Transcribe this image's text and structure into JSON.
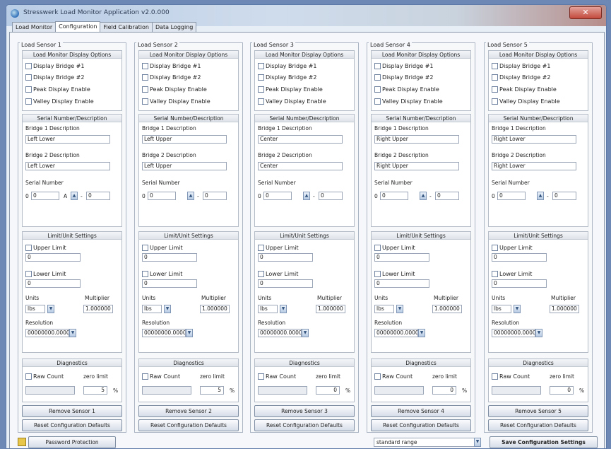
{
  "window": {
    "title": "Stresswerk Load Monitor Application v2.0.000",
    "close_symbol": "✕"
  },
  "tabs": [
    {
      "label": "Load Monitor",
      "active": false
    },
    {
      "label": "Configuration",
      "active": true
    },
    {
      "label": "Field Calibration",
      "active": false
    },
    {
      "label": "Data Logging",
      "active": false
    }
  ],
  "labels": {
    "display_options": "Load Monitor Display Options",
    "display_bridge_1": "Display Bridge #1",
    "display_bridge_2": "Display Bridge #2",
    "peak_display": "Peak Display Enable",
    "valley_display": "Valley Display Enable",
    "serial_group": "Serial Number/Description",
    "bridge1_desc": "Bridge 1 Description",
    "bridge2_desc": "Bridge 2 Description",
    "serial_number": "Serial Number",
    "limit_group": "Limit/Unit Settings",
    "upper_limit": "Upper Limit",
    "lower_limit": "Lower Limit",
    "units": "Units",
    "multiplier": "Multiplier",
    "resolution": "Resolution",
    "diagnostics": "Diagnostics",
    "raw_count": "Raw Count",
    "zero_limit": "zero limit",
    "percent": "%",
    "reset_defaults": "Reset Configuration Defaults"
  },
  "sensors": [
    {
      "title": "Load Sensor 1",
      "bridge1": "Left Lower",
      "bridge2": "Left Lower",
      "sn_prefix": "0",
      "sn_main": "0",
      "sn_letter": "A",
      "sn_suffix": "0",
      "upper": "0",
      "lower": "0",
      "unit": "lbs",
      "multiplier": "1.000000",
      "resolution": "00000000.00000",
      "zero_limit": "5",
      "remove": "Remove Sensor 1"
    },
    {
      "title": "Load Sensor 2",
      "bridge1": "Left Upper",
      "bridge2": "Left Upper",
      "sn_prefix": "0",
      "sn_main": "0",
      "sn_letter": "",
      "sn_suffix": "0",
      "upper": "0",
      "lower": "0",
      "unit": "lbs",
      "multiplier": "1.000000",
      "resolution": "00000000.00000",
      "zero_limit": "5",
      "remove": "Remove Sensor 2"
    },
    {
      "title": "Load Sensor 3",
      "bridge1": "Center",
      "bridge2": "Center",
      "sn_prefix": "0",
      "sn_main": "0",
      "sn_letter": "",
      "sn_suffix": "0",
      "upper": "0",
      "lower": "0",
      "unit": "lbs",
      "multiplier": "1.000000",
      "resolution": "00000000.00000",
      "zero_limit": "0",
      "remove": "Remove Sensor 3"
    },
    {
      "title": "Load Sensor 4",
      "bridge1": "Right Upper",
      "bridge2": "Right Upper",
      "sn_prefix": "0",
      "sn_main": "0",
      "sn_letter": "",
      "sn_suffix": "0",
      "upper": "0",
      "lower": "0",
      "unit": "lbs",
      "multiplier": "1.000000",
      "resolution": "00000000.00000",
      "zero_limit": "0",
      "remove": "Remove Sensor 4"
    },
    {
      "title": "Load Sensor 5",
      "bridge1": "Right Lower",
      "bridge2": "Right Lower",
      "sn_prefix": "0",
      "sn_main": "0",
      "sn_letter": "",
      "sn_suffix": "0",
      "upper": "0",
      "lower": "0",
      "unit": "lbs",
      "multiplier": "1.000000",
      "resolution": "00000000.00000",
      "zero_limit": "0",
      "remove": "Remove Sensor 5"
    }
  ],
  "bottom": {
    "password_button": "Password Protection",
    "range_select": "standard range",
    "save_button": "Save Configuration Settings"
  },
  "colors": {
    "title_gradient_start": "#b9cde6",
    "close_red": "#c24a3c",
    "panel_bg": "#f5f7fa"
  }
}
